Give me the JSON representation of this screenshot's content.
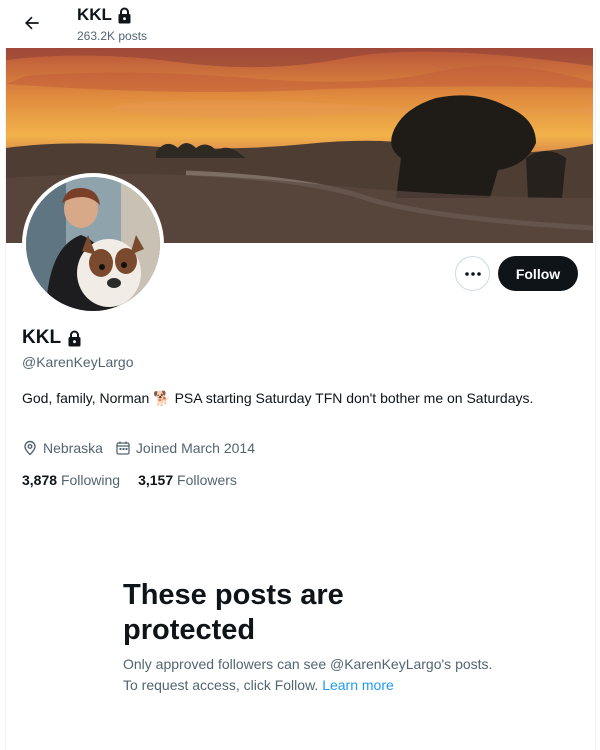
{
  "header": {
    "name": "KKL",
    "posts": "263.2K posts"
  },
  "profile": {
    "name": "KKL",
    "handle": "@KarenKeyLargo",
    "bio_before": "God, family,  Norman",
    "bio_emoji": "🐕",
    "bio_after": "PSA starting Saturday TFN don't bother me on Saturdays.",
    "location": "Nebraska",
    "joined": "Joined March 2014",
    "following_count": "3,878",
    "following_label": "Following",
    "followers_count": "3,157",
    "followers_label": "Followers"
  },
  "actions": {
    "more": "•••",
    "follow": "Follow"
  },
  "protected": {
    "title": "These posts are protected",
    "text": "Only approved followers can see @KarenKeyLargo's posts. To request access, click Follow.",
    "link": "Learn more"
  },
  "icons": {
    "back": "arrow-left-icon",
    "lock": "lock-icon",
    "location": "location-pin-icon",
    "calendar": "calendar-icon",
    "more": "more-dots-icon"
  },
  "colors": {
    "accent": "#1d9bf0",
    "primary_text": "#0f1419",
    "secondary_text": "#536471",
    "follow_bg": "#0f1419"
  }
}
